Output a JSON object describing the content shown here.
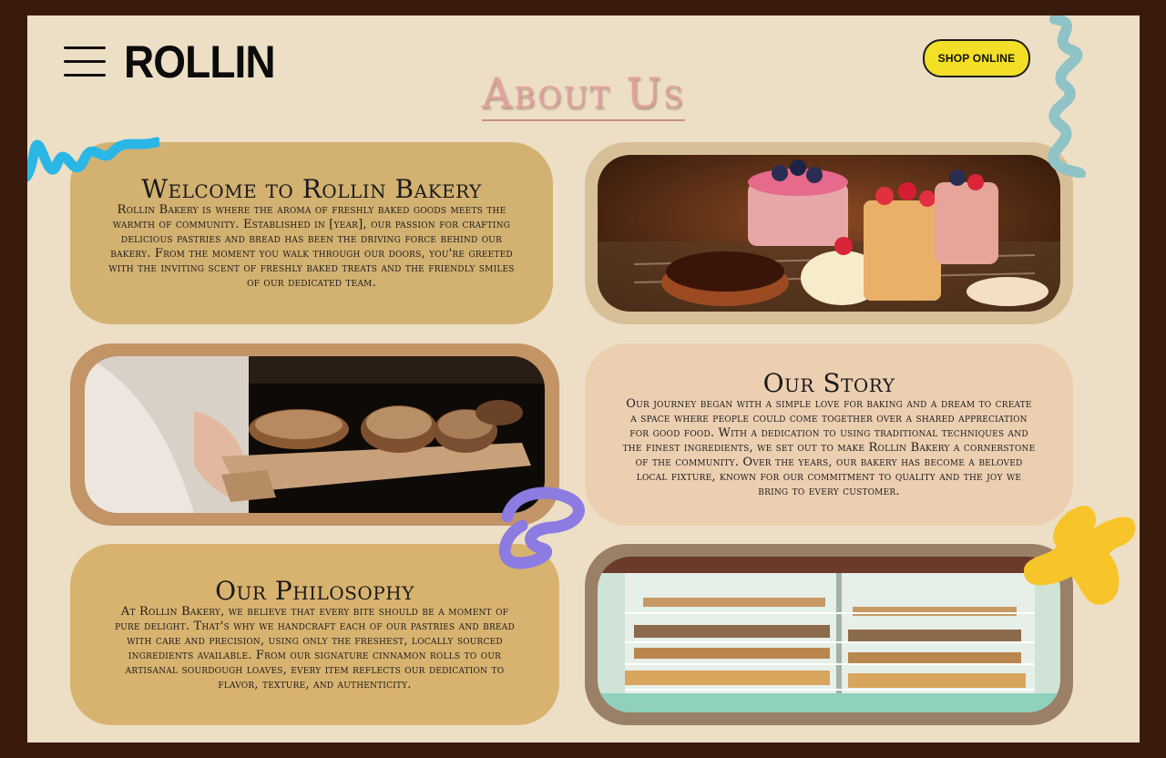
{
  "header": {
    "logo": "ROLLIN",
    "shop_button": "SHOP ONLINE",
    "page_title": "About Us"
  },
  "sections": {
    "welcome": {
      "title": "Welcome to Rollin Bakery",
      "body": "Rollin Bakery is where the aroma of freshly baked goods meets the warmth of community. Established in [year], our passion for crafting delicious pastries and bread has been the driving force behind our bakery. From the moment you walk through our doors, you're greeted with the inviting scent of freshly baked treats and the friendly smiles of our dedicated team."
    },
    "story": {
      "title": "Our Story",
      "body": "Our journey began with a simple love for baking and a dream to create a space where people could come together over a shared appreciation for good food. With a dedication to using traditional techniques and the finest ingredients, we set out to make Rollin Bakery a cornerstone of the community. Over the years, our bakery has become a beloved local fixture, known for our commitment to quality and the joy we bring to every customer."
    },
    "philosophy": {
      "title": "Our Philosophy",
      "body": "At Rollin Bakery, we believe that every bite should be a moment of pure delight. That's why we handcraft each of our pastries and bread with care and precision, using only the freshest, locally sourced ingredients available. From our signature cinnamon rolls to our artisanal sourdough loaves, every item reflects our dedication to flavor, texture, and authenticity."
    }
  },
  "colors": {
    "frame": "#3a1a0c",
    "page": "#eddfc6",
    "title": "#e0a2a0",
    "button": "#f3e026",
    "squiggle_blue": "#2bb7e6",
    "squiggle_teal": "#8fc3c6",
    "squiggle_purple": "#8c7be0",
    "blob_yellow": "#f7c52a"
  },
  "images": {
    "cakes": "cakes-photo",
    "oven": "bread-oven-photo",
    "display": "pastry-display-photo"
  }
}
